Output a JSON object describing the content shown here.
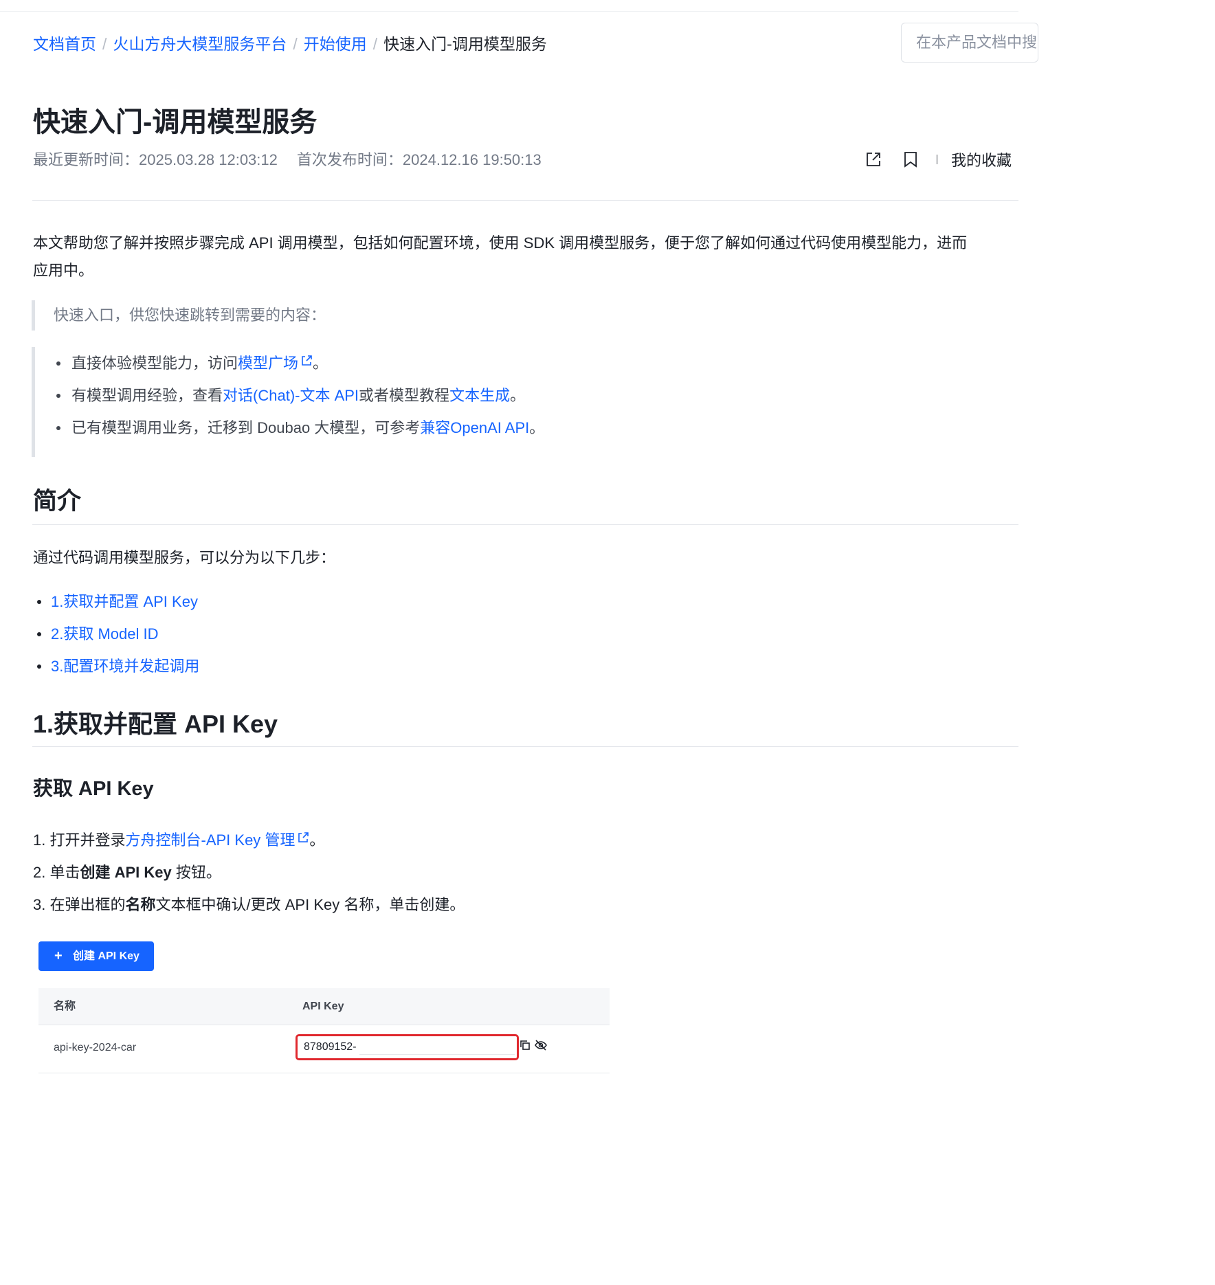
{
  "breadcrumb": {
    "items": [
      "文档首页",
      "火山方舟大模型服务平台",
      "开始使用"
    ],
    "separator": "/",
    "current": "快速入门-调用模型服务"
  },
  "search": {
    "placeholder": "在本产品文档中搜索"
  },
  "article": {
    "title": "快速入门-调用模型服务",
    "updated_label": "最近更新时间：",
    "updated_value": "2025.03.28 12:03:12",
    "published_label": "首次发布时间：",
    "published_value": "2024.12.16 19:50:13",
    "favorites_label": "我的收藏",
    "intro_line1": "本文帮助您了解并按照步骤完成 API 调用模型，包括如何配置环境，使用 SDK 调用模型服务，便于您了解如何通过代码使用模型能力，进而",
    "intro_line2": "应用中。",
    "quick_entry": "快速入口，供您快速跳转到需要的内容：",
    "quick_links": [
      {
        "before": "直接体验模型能力，访问",
        "link": "模型广场",
        "after": "。"
      },
      {
        "before": "有模型调用经验，查看",
        "link": "对话(Chat)-文本 API",
        "middle": "或者模型教程",
        "link2": "文本生成",
        "after": "。"
      },
      {
        "before": "已有模型调用业务，迁移到 Doubao 大模型，可参考",
        "link": "兼容OpenAI API",
        "after": "。"
      }
    ],
    "section_intro_title": "简介",
    "section_intro_text": "通过代码调用模型服务，可以分为以下几步：",
    "toc": [
      "1.获取并配置 API Key",
      "2.获取 Model ID",
      "3.配置环境并发起调用"
    ],
    "section1_title": "1.获取并配置 API Key",
    "sub1_title": "获取 API Key",
    "steps": [
      {
        "num": "1.",
        "before": "打开并登录",
        "link": "方舟控制台-API Key 管理",
        "after": "。"
      },
      {
        "num": "2.",
        "before": "单击",
        "bold": "创建 API Key",
        "after": " 按钮。"
      },
      {
        "num": "3.",
        "before": "在弹出框的",
        "bold": "名称",
        "after": "文本框中确认/更改 API Key 名称，单击创建。"
      }
    ]
  },
  "screenshot_embed": {
    "button_label": "创建 API Key",
    "col_name": "名称",
    "col_key": "API Key",
    "row_name": "api-key-2024-car",
    "row_key": "87809152-",
    "highlight_color": "#e0282e"
  },
  "colors": {
    "link": "#1664ff",
    "text": "#1d2129",
    "muted": "#737a87"
  }
}
